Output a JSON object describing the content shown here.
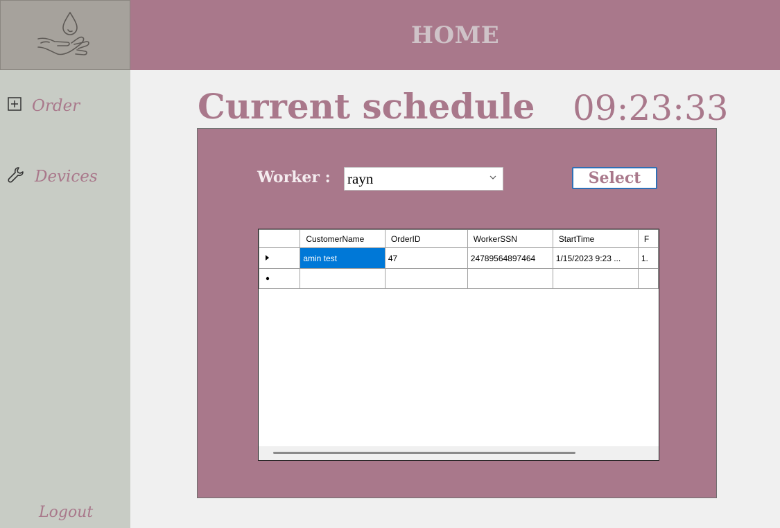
{
  "header": {
    "title": "HOME"
  },
  "logo": {
    "icon": "hand-drop-icon"
  },
  "sidebar": {
    "items": [
      {
        "label": "Order",
        "icon": "plus-square-icon"
      },
      {
        "label": "Devices",
        "icon": "wrench-icon"
      }
    ],
    "logout": "Logout"
  },
  "main": {
    "title": "Current schedule",
    "clock": "09:23:33",
    "worker": {
      "label": "Worker :",
      "value": "rayn"
    },
    "select_button": "Select",
    "grid": {
      "columns": [
        "CustomerName",
        "OrderID",
        "WorkerSSN",
        "StartTime",
        "F"
      ],
      "rows": [
        [
          "amin test",
          "47",
          "24789564897464",
          "1/15/2023 9:23 ...",
          "1."
        ]
      ]
    }
  },
  "colors": {
    "accent": "#a9788b",
    "sidebar": "#c8ccc5",
    "logo_bg": "#a6a29c",
    "selection": "#0078d7",
    "button_border": "#2f6fb5"
  }
}
